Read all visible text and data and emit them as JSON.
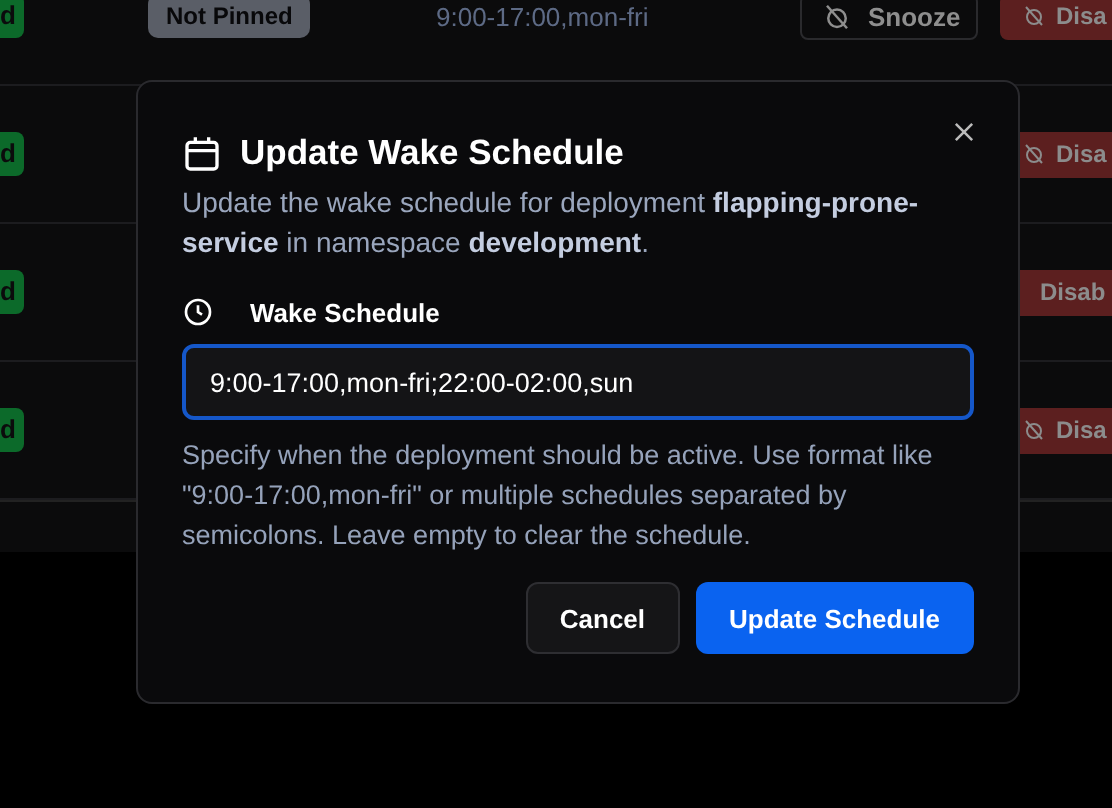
{
  "table": {
    "rows": [
      {
        "status_badge": "d",
        "pin_badge": "Not Pinned",
        "schedule": "9:00-17:00,mon-fri",
        "actions": [
          {
            "kind": "snooze",
            "label": "Snooze"
          },
          {
            "kind": "disable",
            "label": "Disa",
            "icon": true
          }
        ]
      },
      {
        "status_badge": "d",
        "actions": [
          {
            "kind": "disable",
            "label": "Disa",
            "icon": true
          }
        ]
      },
      {
        "status_badge": "d",
        "actions": [
          {
            "kind": "disable",
            "label": "Disab",
            "icon": false
          }
        ]
      },
      {
        "status_badge": "d",
        "actions": [
          {
            "kind": "disable",
            "label": "Disa",
            "icon": true
          }
        ]
      }
    ]
  },
  "dialog": {
    "title": "Update Wake Schedule",
    "description": "Update the wake schedule for deployment **flapping-prone-service** in namespace **development**.",
    "field_label": "Wake Schedule",
    "field_value": "9:00-17:00,mon-fri;22:00-02:00,sun",
    "help": "Specify when the deployment should be active. Use format like \"9:00-17:00,mon-fri\" or multiple schedules separated by semicolons. Leave empty to clear the schedule.",
    "buttons": [
      {
        "kind": "secondary",
        "label": "Cancel"
      },
      {
        "kind": "primary",
        "label": "Update Schedule"
      }
    ]
  }
}
